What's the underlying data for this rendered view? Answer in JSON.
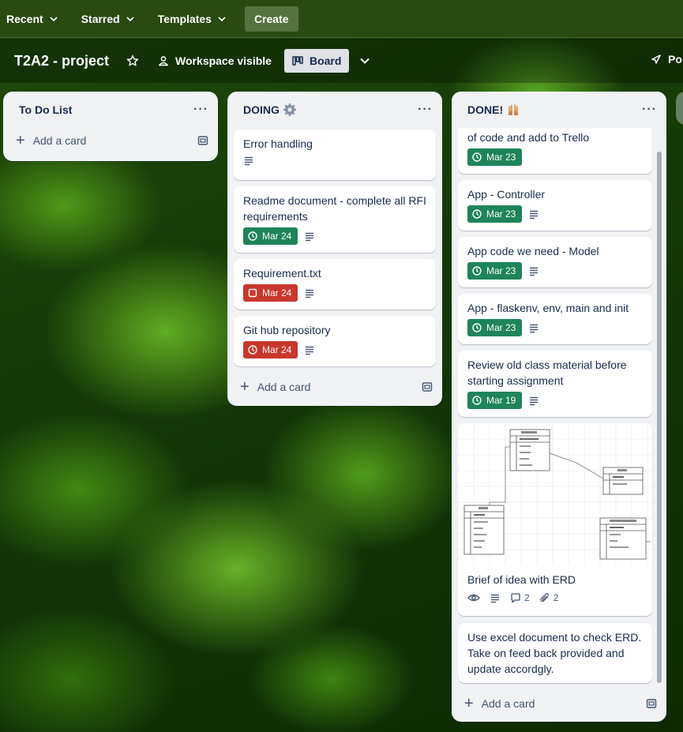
{
  "nav": {
    "recent": "Recent",
    "starred": "Starred",
    "templates": "Templates",
    "create": "Create"
  },
  "board": {
    "title": "T2A2 - project",
    "visibility": "Workspace visible",
    "view": "Board",
    "power_ups": "Po"
  },
  "lists": {
    "todo": {
      "title": "To Do List",
      "add": "Add a card"
    },
    "doing": {
      "title": "DOING",
      "add": "Add a card",
      "cards": [
        {
          "title": "Error handling"
        },
        {
          "title": "Readme document - complete all RFI requirements",
          "due": "Mar 24",
          "due_color": "#1f845a"
        },
        {
          "title": "Requirement.txt",
          "due": "Mar 24",
          "due_color": "#c9372c"
        },
        {
          "title": "Git hub repository",
          "due": "Mar 24",
          "due_color": "#c9372c"
        }
      ]
    },
    "done": {
      "title": "DONE!",
      "add": "Add a card",
      "cards": [
        {
          "title": "of code and add to Trello",
          "due": "Mar 23"
        },
        {
          "title": "App - Controller",
          "due": "Mar 23"
        },
        {
          "title": "App code we need - Model",
          "due": "Mar 23"
        },
        {
          "title": "App - flaskenv, env, main and init",
          "due": "Mar 23"
        },
        {
          "title": "Review old class material before starting assignment",
          "due": "Mar 19"
        },
        {
          "title": "Brief of idea with ERD",
          "comments": "2",
          "attachments": "2"
        },
        {
          "title": "Use excel document to check ERD. Take on feed back provided and update accordgly."
        }
      ]
    }
  },
  "colors": {
    "due_green": "#1f845a",
    "due_red": "#c9372c",
    "nav_bg": "#2b4a10"
  }
}
